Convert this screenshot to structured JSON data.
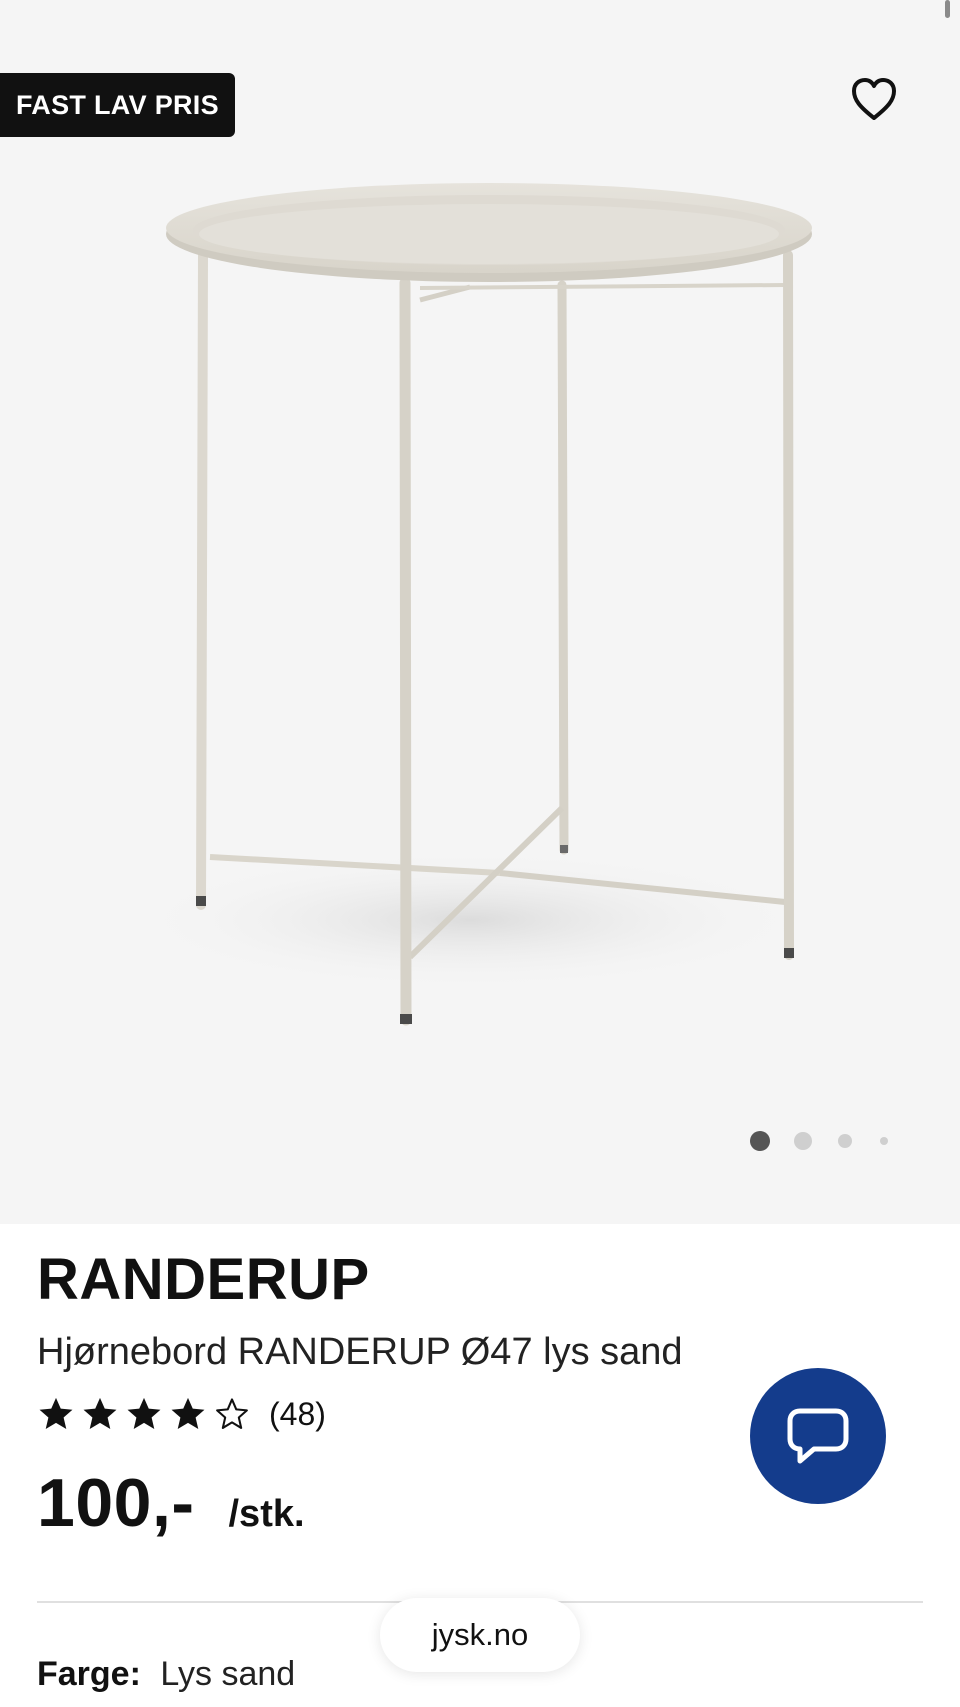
{
  "product": {
    "badge": "FAST LAV PRIS",
    "name": "RANDERUP",
    "description": "Hjørnebord RANDERUP Ø47 lys sand",
    "rating": {
      "stars": 4,
      "max": 5,
      "count_label": "(48)"
    },
    "price": {
      "value": "100,-",
      "unit": "/stk."
    },
    "color": {
      "label": "Farge:",
      "value": "Lys sand"
    }
  },
  "gallery": {
    "image_count": 4,
    "active_index": 0
  },
  "browser": {
    "url": "jysk.no"
  },
  "colors": {
    "accent": "#143c8c",
    "badge_bg": "#111111",
    "image_bg": "#f5f5f5",
    "product": "#dcd8cf"
  },
  "icons": {
    "favorite": "heart-outline-icon",
    "chat": "chat-bubble-icon",
    "star_filled": "star-filled-icon",
    "star_empty": "star-outline-icon"
  }
}
